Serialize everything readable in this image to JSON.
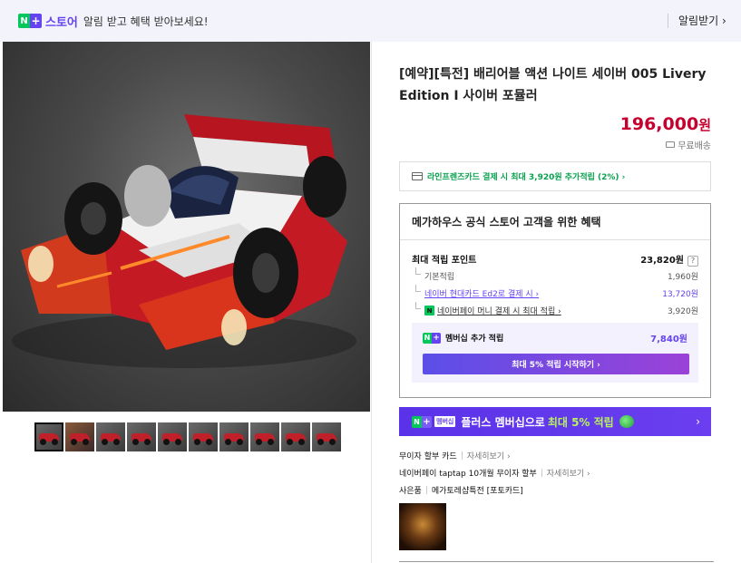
{
  "topbar": {
    "badge_n": "N",
    "badge_plus": "+",
    "store_label": "스토어",
    "message": "알림 받고 혜택 받아보세요!",
    "alarm_label": "알림받기",
    "alarm_chevron": "›"
  },
  "gallery": {
    "thumbnail_count": 10,
    "active_index": 0
  },
  "product": {
    "title": "[예약][특전] 배리어블 액션 나이트 세이버 005 Livery Edition I 사이버 포뮬러",
    "price": "196,000",
    "price_unit": "원",
    "shipping": "무료배송"
  },
  "card_promo": {
    "text": "라인프렌즈카드 결제 시 최대 3,920원 추가적립 (2%) ›"
  },
  "benefit": {
    "header": "메가하우스 공식 스토어 고객을 위한 혜택",
    "max_points_label": "최대 적립 포인트",
    "max_points_value": "23,820원",
    "help": "?",
    "rows": [
      {
        "label": "기본적립",
        "value": "1,960원"
      },
      {
        "label": "네이버 현대카드 Ed2로 결제 시 ›",
        "value": "13,720원"
      },
      {
        "label": "네이버페이 머니 결제 시 최대 적립 ›",
        "value": "3,920원"
      }
    ],
    "npay_icon": "N",
    "member_label": "멤버십 추가 적립",
    "member_value": "7,840원",
    "member_button": "최대 5% 적립 시작하기 ›"
  },
  "plus_banner": {
    "member_tag": "멤버십",
    "text": "플러스 멤버십으로",
    "highlight": "최대 5% 적립",
    "chevron": "›"
  },
  "info": {
    "installment_label": "무이자 할부 카드",
    "installment_more": "자세히보기 ›",
    "taptap_label": "네이버페이 taptap 10개월 무이자 할부",
    "taptap_more": "자세히보기 ›",
    "gift_label": "사은품",
    "gift_value": "메가토레샵특전 [포토카드]"
  }
}
